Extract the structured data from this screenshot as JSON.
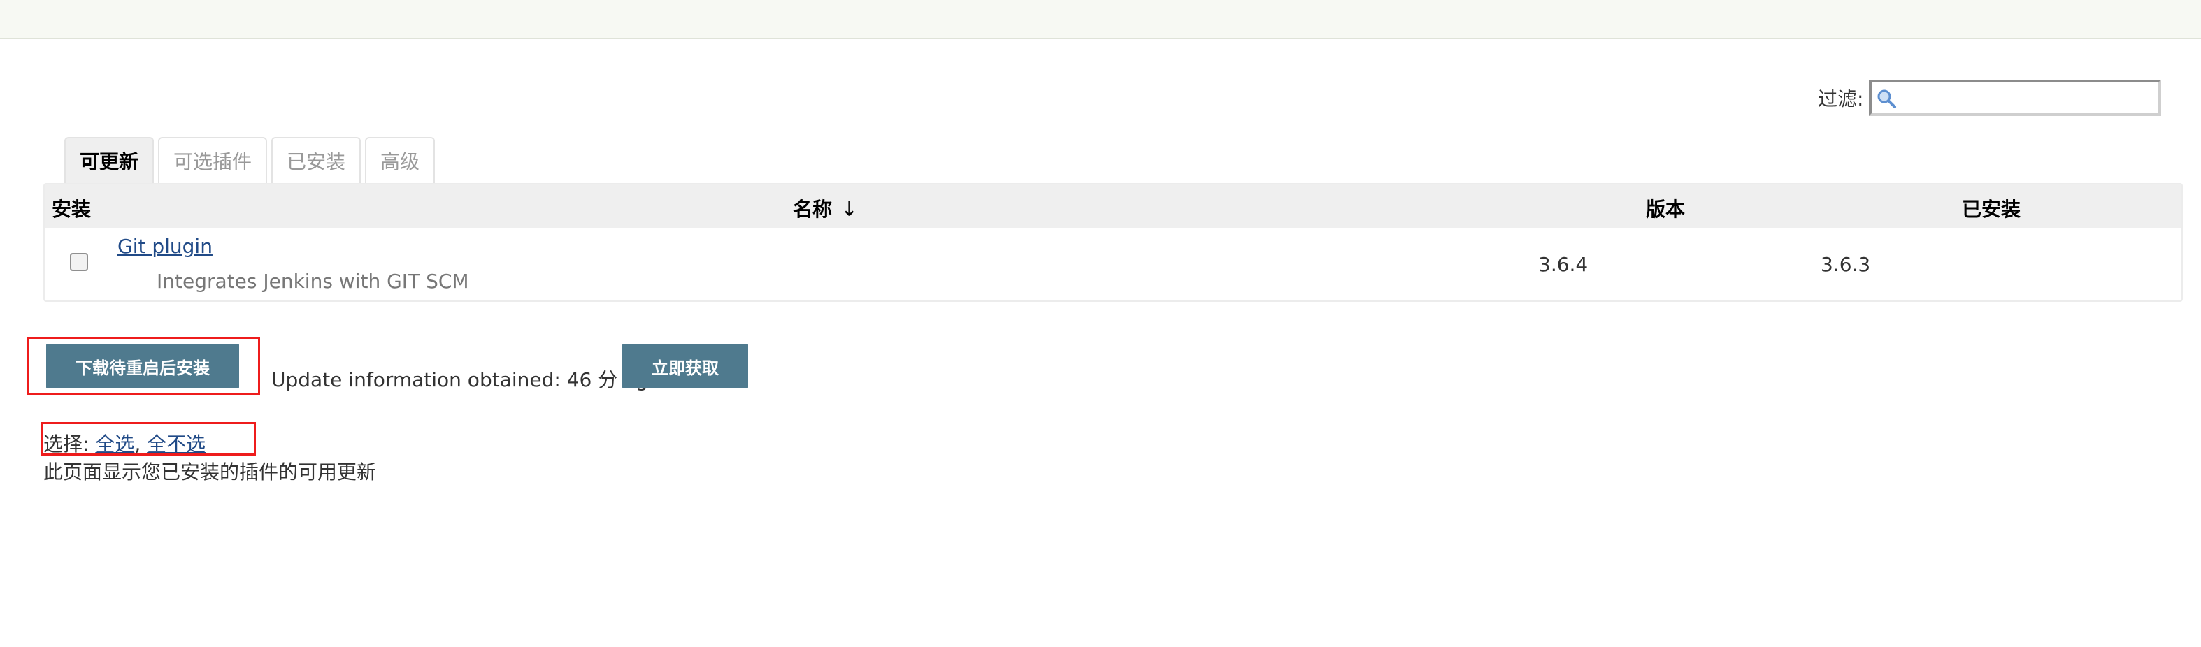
{
  "filter": {
    "label": "过滤:",
    "value": "",
    "icon": "search-icon"
  },
  "tabs": [
    {
      "label": "可更新",
      "active": true
    },
    {
      "label": "可选插件",
      "active": false
    },
    {
      "label": "已安装",
      "active": false
    },
    {
      "label": "高级",
      "active": false
    }
  ],
  "table": {
    "headers": {
      "install": "安装",
      "name": "名称",
      "sort_indicator": "↓",
      "version": "版本",
      "installed": "已安装"
    },
    "rows": [
      {
        "checked": false,
        "name": "Git plugin",
        "description": "Integrates Jenkins with GIT SCM",
        "version": "3.6.4",
        "installed": "3.6.3"
      }
    ]
  },
  "actions": {
    "install_button": "下载待重启后安装",
    "update_info": "Update information obtained: 46 分 ago",
    "fetch_button": "立即获取"
  },
  "selection": {
    "prefix": "选择:",
    "select_all": "全选",
    "separator": ",",
    "select_none": "全不选"
  },
  "page_description": "此页面显示您已安装的插件的可用更新",
  "colors": {
    "button_bg": "#4f7a8e",
    "link": "#204a87",
    "highlight": "#ee1c1c",
    "header_bg": "#efefef"
  }
}
